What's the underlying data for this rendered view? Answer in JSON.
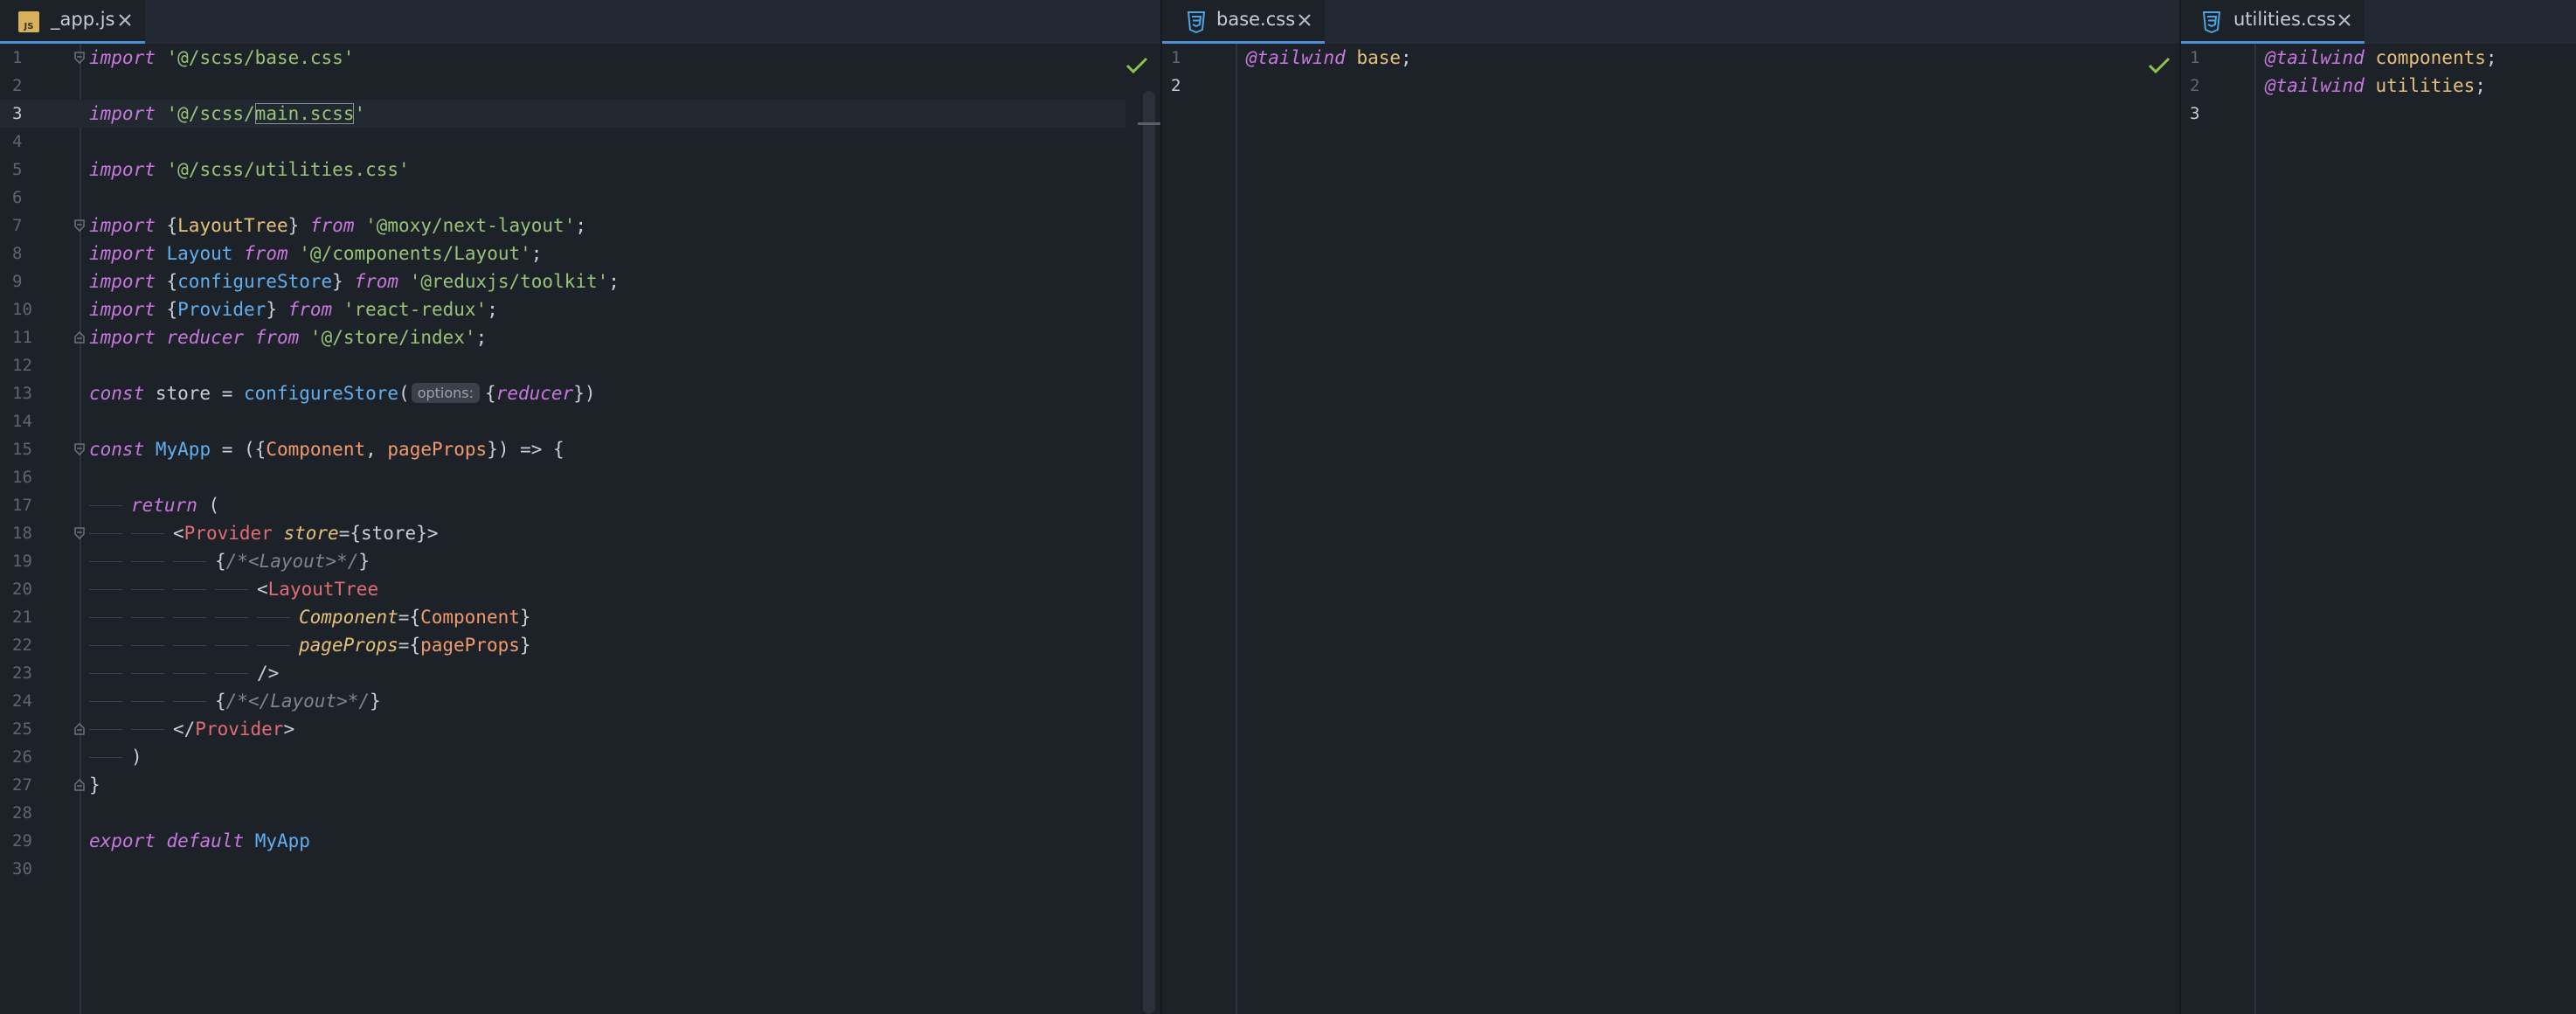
{
  "panes": [
    {
      "tab": {
        "label": "_app.js",
        "icon": "javascript-file-icon",
        "badge": "JS"
      },
      "lines": [
        "1",
        "2",
        "3",
        "4",
        "5",
        "6",
        "7",
        "8",
        "9",
        "10",
        "11",
        "12",
        "13",
        "14",
        "15",
        "16",
        "17",
        "18",
        "19",
        "20",
        "21",
        "22",
        "23",
        "24",
        "25",
        "26",
        "27",
        "28",
        "29",
        "30"
      ],
      "current_line": "3",
      "status": "no-problems-check-icon",
      "code": {
        "l1": [
          "import",
          " ",
          "'@/scss/base.css'"
        ],
        "l3": [
          "import",
          " ",
          "'@/scss/",
          "main.scss",
          "'"
        ],
        "l5": [
          "import",
          " ",
          "'@/scss/utilities.css'"
        ],
        "l7": [
          "import",
          " {",
          "LayoutTree",
          "} ",
          "from",
          " ",
          "'@moxy/next-layout'",
          ";"
        ],
        "l8": [
          "import",
          " ",
          "Layout",
          " ",
          "from",
          " ",
          "'@/components/Layout'",
          ";"
        ],
        "l9": [
          "import",
          " {",
          "configureStore",
          "} ",
          "from",
          " ",
          "'@reduxjs/toolkit'",
          ";"
        ],
        "l10": [
          "import",
          " {",
          "Provider",
          "} ",
          "from",
          " ",
          "'react-redux'",
          ";"
        ],
        "l11": [
          "import",
          " ",
          "reducer",
          " ",
          "from",
          " ",
          "'@/store/index'",
          ";"
        ],
        "l13": [
          "const",
          " store = ",
          "configureStore",
          "(",
          "options:",
          "{",
          "reducer",
          "})"
        ],
        "l15": [
          "const",
          " ",
          "MyApp",
          " = ({",
          "Component",
          ", ",
          "pageProps",
          "}) => {"
        ],
        "l17": [
          "return",
          " ("
        ],
        "l18": [
          "<",
          "Provider",
          " ",
          "store",
          "={store}>"
        ],
        "l19": [
          "{",
          "/*<Layout>*/",
          "}"
        ],
        "l20": [
          "<",
          "LayoutTree"
        ],
        "l21": [
          "Component",
          "={",
          "Component",
          "}"
        ],
        "l22": [
          "pageProps",
          "={",
          "pageProps",
          "}"
        ],
        "l23": [
          "/>"
        ],
        "l24": [
          "{",
          "/*</Layout>*/",
          "}"
        ],
        "l25": [
          "</",
          "Provider",
          ">"
        ],
        "l26": [
          ")"
        ],
        "l27": [
          "}"
        ],
        "l29": [
          "export",
          " ",
          "default",
          " ",
          "MyApp"
        ]
      }
    },
    {
      "tab": {
        "label": "base.css",
        "icon": "css-file-icon"
      },
      "lines": [
        "1",
        "2"
      ],
      "current_line": "2",
      "status": "no-problems-check-icon",
      "code": {
        "l1": [
          "@tailwind",
          " ",
          "base",
          ";"
        ]
      }
    },
    {
      "tab": {
        "label": "utilities.css",
        "icon": "css-file-icon"
      },
      "lines": [
        "1",
        "2",
        "3"
      ],
      "current_line": "3",
      "code": {
        "l1": [
          "@tailwind",
          " ",
          "components",
          ";"
        ],
        "l2": [
          "@tailwind",
          " ",
          "utilities",
          ";"
        ]
      }
    }
  ],
  "colors": {
    "background": "#1d2229",
    "tabbar": "#232932",
    "keyword": "#c678dd",
    "string": "#98c379",
    "function": "#61afef",
    "class": "#e5c07b",
    "tag": "#e06c75",
    "param": "#ef9a6f",
    "comment": "#7f848e",
    "tab_accent": "#4b8fd6",
    "check": "#8fc24a"
  }
}
